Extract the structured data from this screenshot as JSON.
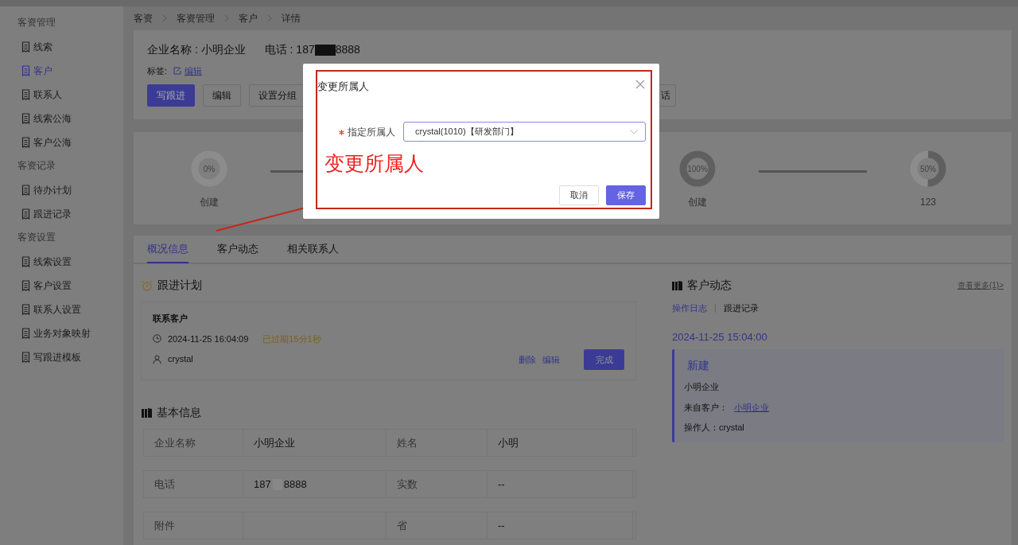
{
  "sidebar": {
    "groups": [
      {
        "title": "客资管理",
        "items": [
          {
            "label": "线索",
            "selected": false
          },
          {
            "label": "客户",
            "selected": true
          },
          {
            "label": "联系人",
            "selected": false
          },
          {
            "label": "线索公海",
            "selected": false
          },
          {
            "label": "客户公海",
            "selected": false
          }
        ]
      },
      {
        "title": "客资记录",
        "items": [
          {
            "label": "待办计划",
            "selected": false
          },
          {
            "label": "跟进记录",
            "selected": false
          }
        ]
      },
      {
        "title": "客资设置",
        "items": [
          {
            "label": "线索设置",
            "selected": false
          },
          {
            "label": "客户设置",
            "selected": false
          },
          {
            "label": "联系人设置",
            "selected": false
          },
          {
            "label": "业务对象映射",
            "selected": false
          },
          {
            "label": "写跟进模板",
            "selected": false
          }
        ]
      }
    ]
  },
  "breadcrumb": [
    "客资",
    "客资管理",
    "客户",
    "详情"
  ],
  "header": {
    "company": "企业名称 : 小明企业",
    "phone_prefix": "电话 : 187",
    "phone_suffix": "8888",
    "tags_label": "标签:",
    "tags_edit": "编辑",
    "buttons": [
      {
        "label": "写跟进",
        "primary": true
      },
      {
        "label": "编辑",
        "primary": false
      },
      {
        "label": "设置分组",
        "primary": false
      }
    ],
    "partial_button": "话"
  },
  "stages": [
    {
      "percent": "0%",
      "level": 0,
      "label": "创建"
    },
    {
      "percent": "100%",
      "level": 1,
      "label": "创建"
    },
    {
      "percent": "50%",
      "level": 0.5,
      "label": "123"
    }
  ],
  "tabs": [
    {
      "label": "概况信息",
      "selected": true
    },
    {
      "label": "客户动态",
      "selected": false
    },
    {
      "label": "相关联系人",
      "selected": false
    }
  ],
  "follow_plan": {
    "title": "跟进计划",
    "task": "联系客户",
    "time": "2024-11-25 16:04:09",
    "overdue": "已过期15分1秒",
    "owner": "crystal",
    "actions": [
      "删除",
      "编辑"
    ],
    "complete": "完成"
  },
  "basic_info": {
    "title": "基本信息",
    "rows": [
      [
        {
          "label": "企业名称",
          "value": "小明企业"
        },
        {
          "label": "姓名",
          "value": "小明"
        }
      ],
      [
        {
          "label": "电话",
          "value": "187",
          "value_suffix": "8888"
        },
        {
          "label": "实数",
          "value": "--"
        }
      ],
      [
        {
          "label": "附件"
        },
        {
          "label": "省",
          "value": "--"
        }
      ]
    ]
  },
  "activity": {
    "title": "客户动态",
    "more": "查看更多(1)>",
    "filters": [
      {
        "label": "操作日志",
        "selected": true
      },
      {
        "label": "跟进记录",
        "selected": false
      }
    ],
    "date": "2024-11-25 15:04:00",
    "entry": {
      "title": "新建",
      "company": "小明企业",
      "from_label": "来自客户：",
      "from_value": "小明企业",
      "operator": "操作人：crystal"
    }
  },
  "modal": {
    "title": "变更所属人",
    "field_label": "指定所属人",
    "required": true,
    "value": "crystal(1010)【研发部门】",
    "buttons": [
      {
        "label": "取消",
        "primary": false
      },
      {
        "label": "保存",
        "primary": true
      }
    ]
  },
  "annotation": {
    "text": "变更所属人"
  }
}
